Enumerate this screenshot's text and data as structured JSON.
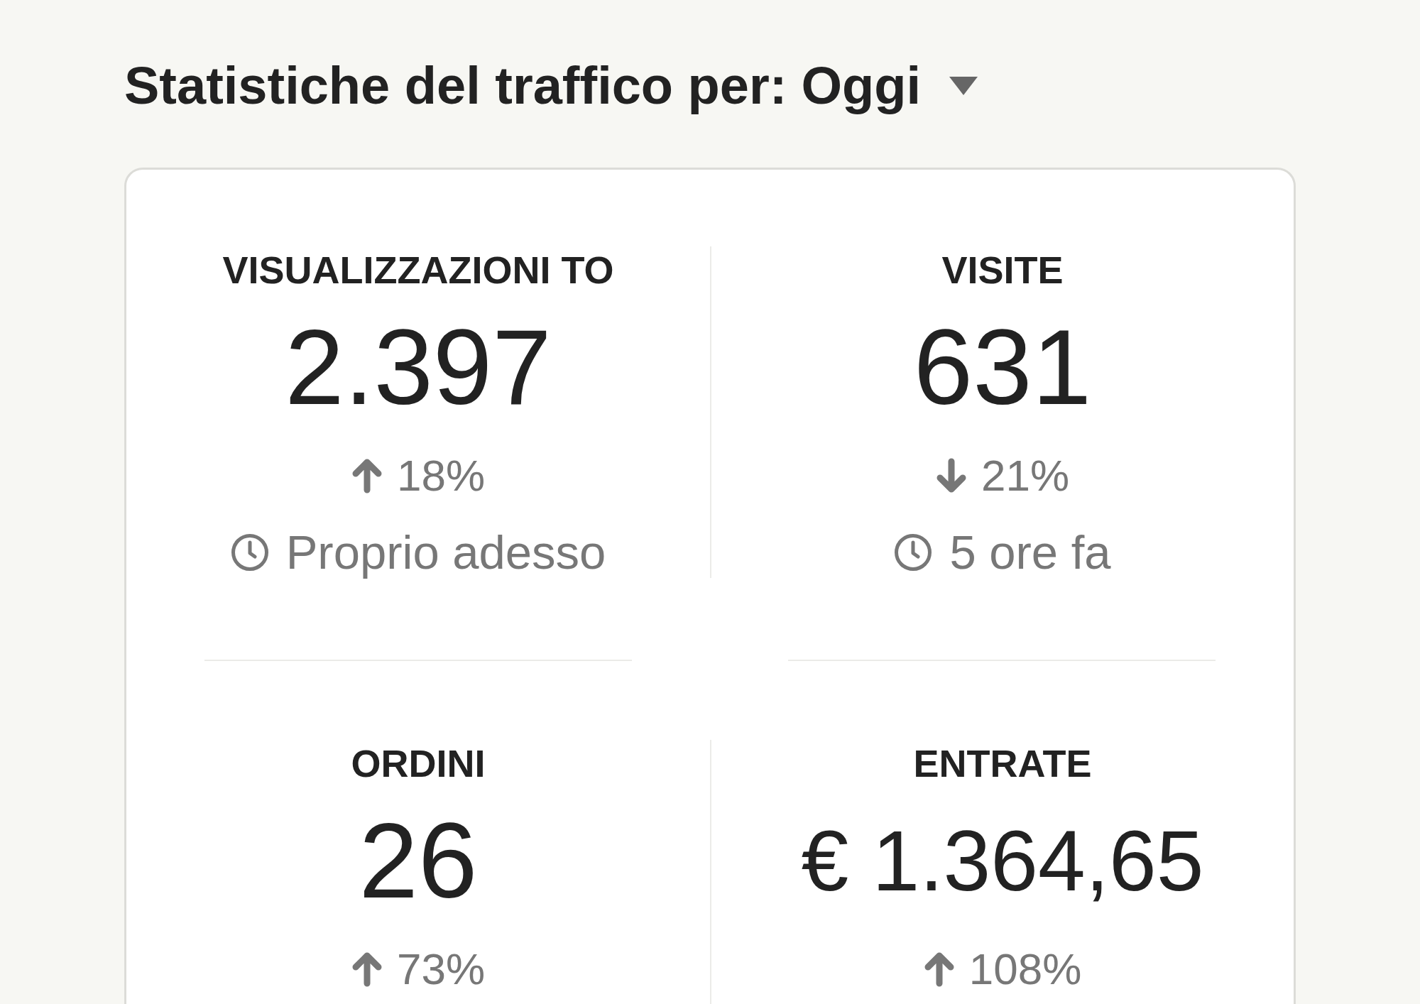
{
  "header": {
    "title": "Statistiche del traffico per:",
    "period": "Oggi"
  },
  "stats": [
    {
      "label": "VISUALIZZAZIONI TO",
      "value": "2.397",
      "change": {
        "kind": "up",
        "text": "18%"
      },
      "updated": "Proprio adesso"
    },
    {
      "label": "VISITE",
      "value": "631",
      "change": {
        "kind": "down",
        "text": "21%"
      },
      "updated": "5 ore fa"
    },
    {
      "label": "ORDINI",
      "value": "26",
      "change": {
        "kind": "up",
        "text": "73%"
      }
    },
    {
      "label": "ENTRATE",
      "value": "€ 1.364,65",
      "change": {
        "kind": "up",
        "text": "108%"
      }
    }
  ]
}
